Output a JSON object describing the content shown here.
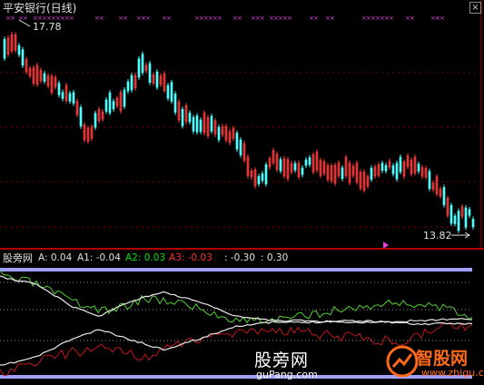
{
  "main_chart": {
    "title": "平安银行(日线)",
    "high_label": "17.78",
    "low_label": "13.82",
    "colors": {
      "up": "#ff4040",
      "down": "#54fcfc",
      "marker": "#e040e0",
      "axis_red": "#b00000",
      "dash": "#7a0000"
    }
  },
  "indicator": {
    "name": "股旁网",
    "values": [
      {
        "label": "A: 0.04",
        "color": "#e0e0e0"
      },
      {
        "label": "A1: -0.04",
        "color": "#e0e0e0"
      },
      {
        "label": "A2: 0.03",
        "color": "#00e000"
      },
      {
        "label": "A3: -0.03",
        "color": "#ff3030"
      },
      {
        "label": ": -0.30",
        "color": "#e0e0e0"
      },
      {
        "label": ": 0.30",
        "color": "#e0e0e0"
      }
    ],
    "colors": {
      "A": "#e8e8e8",
      "A1": "#e8e8e8",
      "A2": "#50d030",
      "A3": "#c01818",
      "band": "#a0a0ff",
      "dots": "#909090"
    }
  },
  "watermark": {
    "text": "股旁网",
    "url": "guPang.com",
    "brand": "智股网",
    "brand_url": "www.zhigu.com"
  },
  "close_glyph": "×"
}
